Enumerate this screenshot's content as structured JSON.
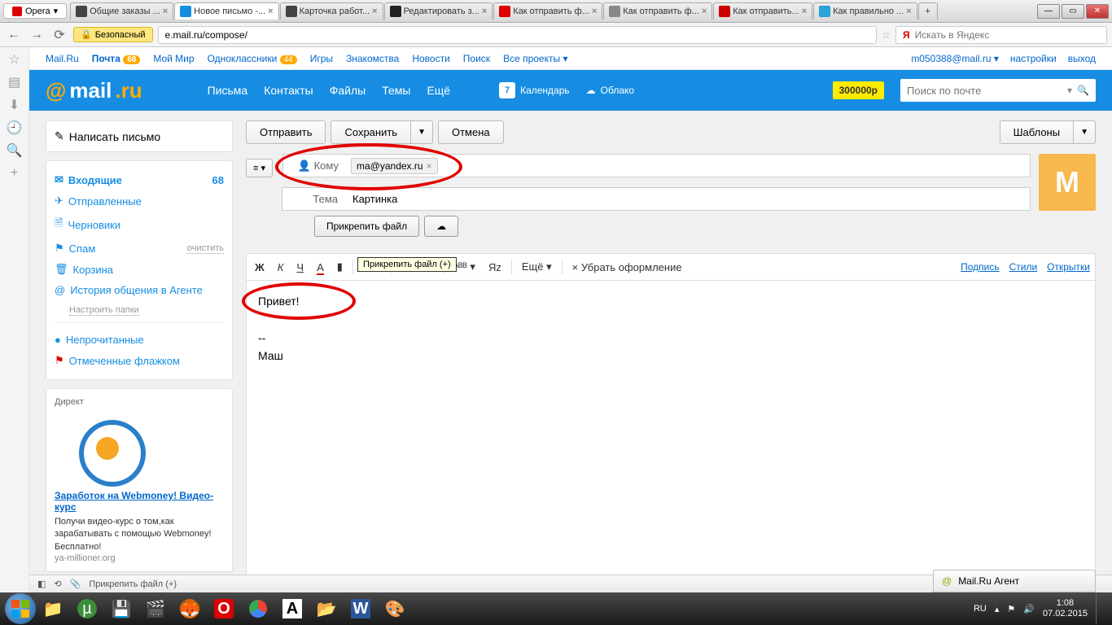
{
  "titlebar": {
    "opera": "Opera"
  },
  "tabs": [
    {
      "label": "Общие заказы ..."
    },
    {
      "label": "Новое письмо -..."
    },
    {
      "label": "Карточка работ..."
    },
    {
      "label": "Редактировать з..."
    },
    {
      "label": "Как отправить ф..."
    },
    {
      "label": "Как отправить ф..."
    },
    {
      "label": "Как отправить..."
    },
    {
      "label": "Как правильно ..."
    }
  ],
  "addr": {
    "secure": "Безопасный",
    "url": "e.mail.ru/compose/",
    "yandex_ph": "Искать в Яндекс"
  },
  "toplinks": {
    "mailru": "Mail.Ru",
    "pochta": "Почта",
    "pochta_badge": "68",
    "moymir": "Мой Мир",
    "odnok": "Одноклассники",
    "odnok_badge": "44",
    "igry": "Игры",
    "znak": "Знакомства",
    "novosti": "Новости",
    "poisk": "Поиск",
    "vse": "Все проекты",
    "email": "m050388@mail.ru",
    "settings": "настройки",
    "exit": "выход"
  },
  "header": {
    "logo_mail": "mail",
    "logo_ru": ".ru",
    "pisma": "Письма",
    "kontakty": "Контакты",
    "faily": "Файлы",
    "temy": "Темы",
    "eshche": "Ещё",
    "cal_num": "7",
    "kalendar": "Календарь",
    "oblako": "Облако",
    "promo": "300000р",
    "search_ph": "Поиск по почте"
  },
  "sidebar": {
    "compose": "Написать письмо",
    "folders": {
      "inbox": "Входящие",
      "inbox_count": "68",
      "sent": "Отправленные",
      "drafts": "Черновики",
      "spam": "Спам",
      "spam_clear": "очистить",
      "trash": "Корзина",
      "agent": "История общения в Агенте",
      "configure": "Настроить папки",
      "unread": "Непрочитанные",
      "flagged": "Отмеченные флажком"
    },
    "direct": {
      "head": "Директ",
      "title": "Заработок на Webmoney! Видео-курс",
      "text": "Получи видео-курс о том,как зарабатывать с помощью Webmoney! Бесплатно!",
      "url": "ya-millioner.org"
    }
  },
  "compose": {
    "send": "Отправить",
    "save": "Сохранить",
    "cancel": "Отмена",
    "templates": "Шаблоны",
    "to_label": "Кому",
    "to_value": "ma@yandex.ru",
    "subj_label": "Тема",
    "subj_value": "Картинка",
    "attach": "Прикрепить файл",
    "avatar": "М",
    "toolbar": {
      "bold": "Ж",
      "italic": "К",
      "underline": "Ч",
      "color": "А",
      "tooltip": "Прикрепить файл (+)",
      "more": "Ещё",
      "remove_fmt": "Убрать оформление",
      "sign": "Подпись",
      "styles": "Стили",
      "cards": "Открытки"
    },
    "body_greeting": "Привет!",
    "body_sep": "--",
    "body_sig": "Маш"
  },
  "agent_bar": "Mail.Ru Агент",
  "statusbar": {
    "attach": "Прикрепить файл (+)"
  },
  "taskbar": {
    "lang": "RU",
    "time": "1:08",
    "date": "07.02.2015"
  }
}
